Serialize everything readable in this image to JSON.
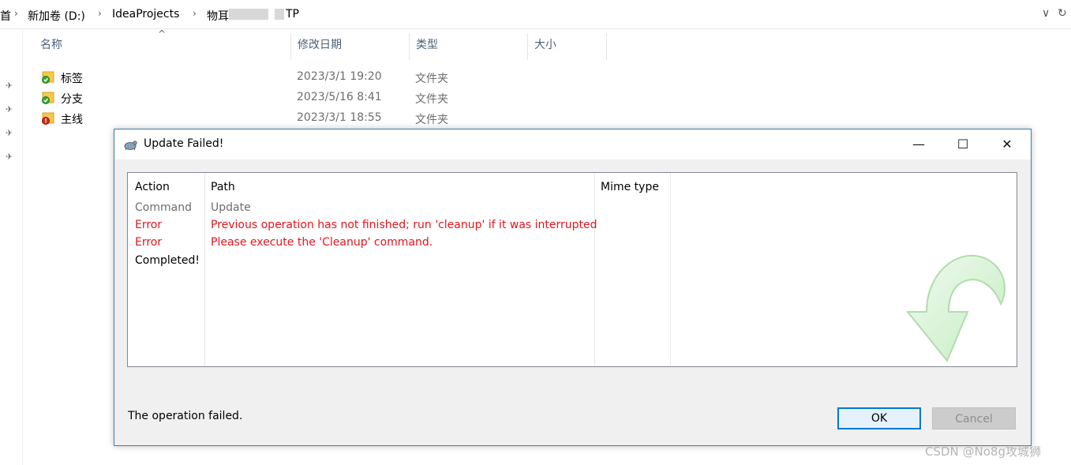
{
  "address": {
    "crumbs": [
      "首",
      "新加卷 (D:)",
      "IdeaProjects",
      "物耳",
      "TP"
    ],
    "separator": "›",
    "dropdown_glyph": "∨",
    "refresh_glyph": "↻"
  },
  "sidebar": {
    "pin_glyph": "✈"
  },
  "file_list": {
    "sort_indicator": "^",
    "columns": [
      "名称",
      "修改日期",
      "类型",
      "大小"
    ],
    "rows": [
      {
        "name": "标签",
        "date": "2023/3/1 19:20",
        "type": "文件夹",
        "status": "ok"
      },
      {
        "name": "分支",
        "date": "2023/5/16 8:41",
        "type": "文件夹",
        "status": "ok"
      },
      {
        "name": "主线",
        "date": "2023/3/1 18:55",
        "type": "文件夹",
        "status": "conflict"
      }
    ]
  },
  "dialog": {
    "title": "Update Failed!",
    "window_controls": {
      "minimize": "—",
      "maximize": "☐",
      "close": "✕"
    },
    "columns": [
      "Action",
      "Path",
      "Mime type"
    ],
    "log": [
      {
        "action": "Command",
        "path": "Update",
        "kind": "info"
      },
      {
        "action": "Error",
        "path": "Previous operation has not finished; run 'cleanup' if it was interrupted",
        "kind": "error"
      },
      {
        "action": "Error",
        "path": "Please execute the 'Cleanup' command.",
        "kind": "error"
      },
      {
        "action": "Completed!",
        "path": "",
        "kind": "done"
      }
    ],
    "status_text": "The operation failed.",
    "ok_label": "OK",
    "cancel_label": "Cancel"
  },
  "colors": {
    "error": "#e8141c",
    "accent": "#0078d7",
    "ok_badge": "#3aa935",
    "conflict_badge": "#d9261c"
  },
  "watermark": "CSDN @No8g攻城狮"
}
